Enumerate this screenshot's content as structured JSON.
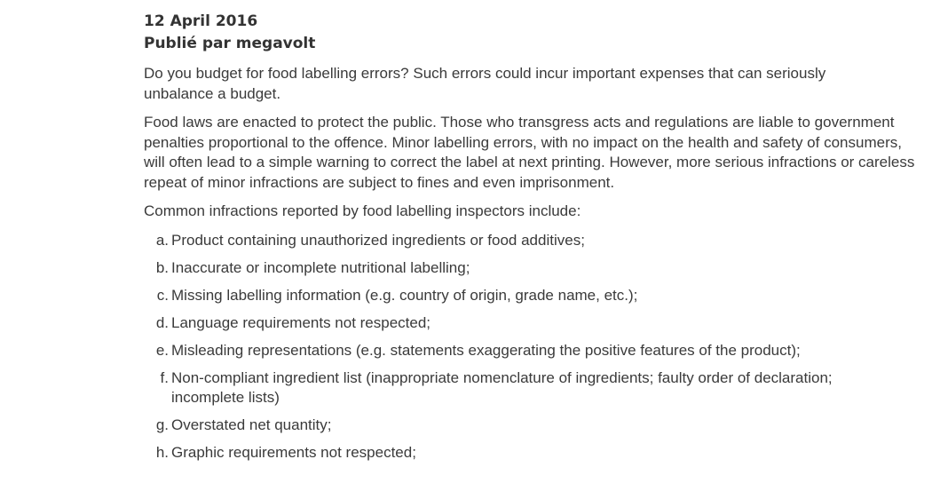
{
  "meta": {
    "date": "12 April 2016",
    "published_by": "Publié par megavolt"
  },
  "body": {
    "paragraphs": [
      "Do you budget for food labelling errors? Such errors could incur important expenses that can seriously unbalance a budget.",
      "Food laws are enacted to protect the public. Those who transgress acts and regulations are liable to government penalties proportional to the offence. Minor labelling errors, with no impact on the health and safety of consumers, will often lead to a simple warning to correct the label at next printing. However, more serious infractions or careless repeat of minor infractions are subject to fines and even imprisonment.",
      "Common infractions reported by food labelling inspectors include:"
    ],
    "list": [
      {
        "marker": "a.",
        "text": "Product containing unauthorized ingredients or food additives;"
      },
      {
        "marker": "b.",
        "text": "Inaccurate or incomplete nutritional labelling;"
      },
      {
        "marker": "c.",
        "text": "Missing labelling information (e.g. country of origin, grade name, etc.);"
      },
      {
        "marker": "d.",
        "text": "Language requirements not respected;"
      },
      {
        "marker": "e.",
        "text": "Misleading representations (e.g. statements exaggerating the positive features of the product);"
      },
      {
        "marker": "f.",
        "text": "Non-compliant ingredient list (inappropriate nomenclature of ingredients; faulty order of declaration; incomplete lists)"
      },
      {
        "marker": "g.",
        "text": "Overstated net quantity;"
      },
      {
        "marker": "h.",
        "text": "Graphic requirements not respected;"
      }
    ]
  }
}
